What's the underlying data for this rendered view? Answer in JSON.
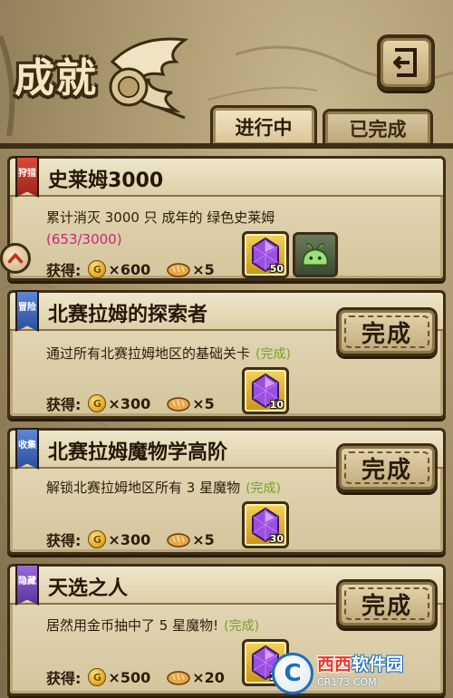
{
  "header": {
    "title": "成就",
    "back_icon": "return-arrow-icon"
  },
  "tabs": [
    {
      "label": "进行中",
      "active": true
    },
    {
      "label": "已完成",
      "active": false
    }
  ],
  "colors": {
    "frame": "#3f2d15",
    "parchment": "#e7dcbc",
    "progress_text": "#c2287a",
    "done_text": "#7aa02a"
  },
  "reward_label": "获得:",
  "achievements": [
    {
      "ribbon": "狩猎",
      "ribbon_color": "red",
      "title": "史莱姆3000",
      "description": "累计消灭 3000 只 成年的 绿色史莱姆",
      "progress": "(653/3000)",
      "gold": "×600",
      "bread": "×5",
      "gem_count": "50",
      "extra_reward_icon": "green-slime-icon"
    },
    {
      "ribbon": "冒险",
      "ribbon_color": "blue",
      "title": "北赛拉姆的探索者",
      "description": "通过所有北赛拉姆地区的基础关卡",
      "status_note": "(完成)",
      "gold": "×300",
      "bread": "×5",
      "gem_count": "10",
      "button": "完成"
    },
    {
      "ribbon": "收集",
      "ribbon_color": "blue",
      "title": "北赛拉姆魔物学高阶",
      "description": "解锁北赛拉姆地区所有 3 星魔物",
      "status_note": "(完成)",
      "gold": "×300",
      "bread": "×5",
      "gem_count": "30",
      "button": "完成"
    },
    {
      "ribbon": "隐藏",
      "ribbon_color": "purple",
      "title": "天选之人",
      "description": "居然用金币抽中了 5 星魔物!",
      "status_note": "(完成)",
      "gold": "×500",
      "bread": "×20",
      "gem_count": "20",
      "button": "完成"
    }
  ],
  "watermark": {
    "logo": "C",
    "brand_red": "西西",
    "brand_rest": "软件园",
    "url": "CR173.COM"
  }
}
